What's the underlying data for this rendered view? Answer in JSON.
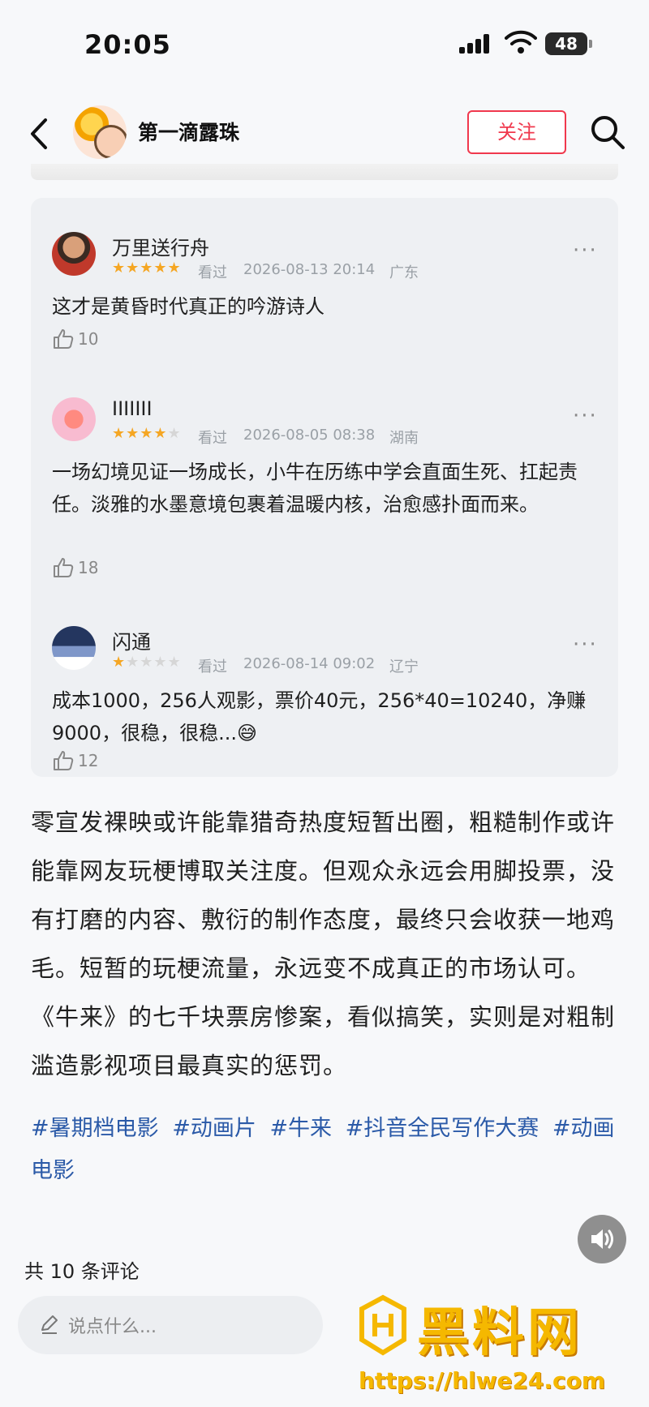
{
  "status": {
    "time": "20:05",
    "battery": "48"
  },
  "header": {
    "author": "第一滴露珠",
    "follow_label": "关注"
  },
  "comments": [
    {
      "name": "万里送行舟",
      "rating": 5,
      "watched": "看过",
      "time": "2026-08-13 20:14",
      "location": "广东",
      "text": "这才是黄昏时代真正的吟游诗人",
      "likes": "10"
    },
    {
      "name": "IIIIIII",
      "rating": 4,
      "watched": "看过",
      "time": "2026-08-05 08:38",
      "location": "湖南",
      "text": "一场幻境见证一场成长，小牛在历练中学会直面生死、扛起责任。淡雅的水墨意境包裹着温暖内核，治愈感扑面而来。",
      "likes": "18"
    },
    {
      "name": "闪通",
      "rating": 1,
      "watched": "看过",
      "time": "2026-08-14 09:02",
      "location": "辽宁",
      "text": "成本1000，256人观影，票价40元，256*40=10240，净赚9000，很稳，很稳...😅",
      "likes": "12"
    }
  ],
  "article": {
    "body": "零宣发裸映或许能靠猎奇热度短暂出圈，粗糙制作或许能靠网友玩梗博取关注度。但观众永远会用脚投票，没有打磨的内容、敷衍的制作态度，最终只会收获一地鸡毛。短暂的玩梗流量，永远变不成真正的市场认可。《牛来》的七千块票房惨案，看似搞笑，实则是对粗制滥造影视项目最真实的惩罚。",
    "tags": [
      "#暑期档电影",
      "#动画片",
      "#牛来",
      "#抖音全民写作大赛",
      "#动画电影"
    ]
  },
  "footer": {
    "comment_count": "共 10 条评论",
    "input_placeholder": "说点什么..."
  },
  "watermark": {
    "title": "黑料网",
    "url": "https://hlwe24.com"
  },
  "colors": {
    "accent": "#f0384d",
    "tag": "#2b5aa8",
    "star": "#f5a623",
    "watermark": "#f5b800"
  }
}
